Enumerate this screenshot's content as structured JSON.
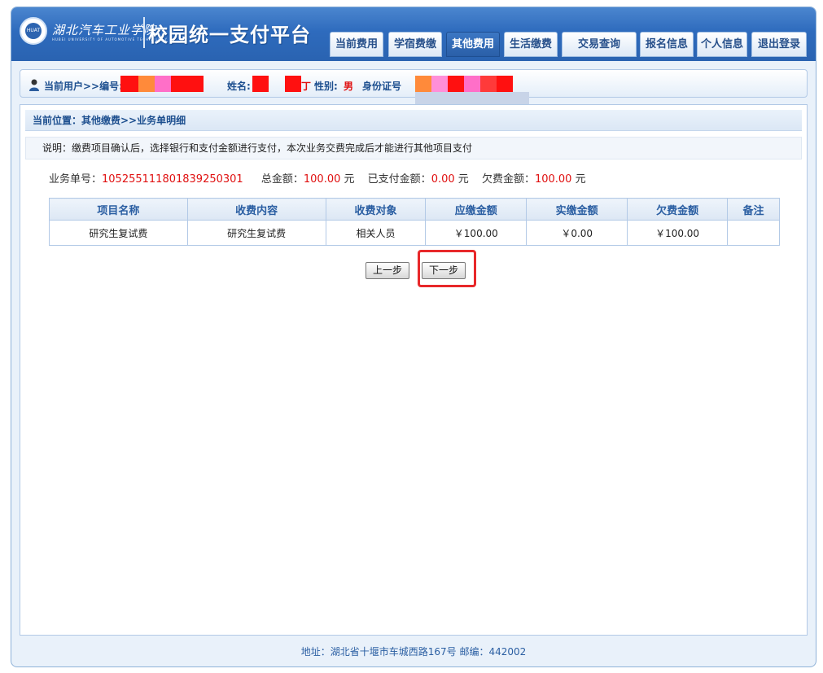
{
  "header": {
    "school_name": "湖北汽车工业学院",
    "school_name_en": "HUBEI UNIVERSITY OF AUTOMOTIVE TECHNOLOGY",
    "platform_title": "校园统一支付平台",
    "emblem_text": "HUAT",
    "nav": [
      {
        "label": "当前费用",
        "active": false
      },
      {
        "label": "学宿费缴",
        "active": false
      },
      {
        "label": "其他费用",
        "active": true
      },
      {
        "label": "生活缴费",
        "active": false
      },
      {
        "label": "交易查询",
        "active": false
      },
      {
        "label": "报名信息",
        "active": false
      },
      {
        "label": "个人信息",
        "active": false
      },
      {
        "label": "退出登录",
        "active": false
      }
    ]
  },
  "user_bar": {
    "current_user_label": "当前用户>>编号:",
    "name_label": "姓名:",
    "name_tail": "丁",
    "gender_label": "性别:",
    "gender_value": "男",
    "id_label": "身份证号"
  },
  "breadcrumb": "当前位置：其他缴费>>业务单明细",
  "notice": "说明：缴费项目确认后，选择银行和支付金额进行支付，本次业务交费完成后才能进行其他项目支付",
  "summary": {
    "order_label": "业务单号：",
    "order_value": "105255111801839250301",
    "total_label": "总金额：",
    "total_value": "100.00",
    "paid_label": "已支付金额：",
    "paid_value": "0.00",
    "owed_label": "欠费金额：",
    "owed_value": "100.00",
    "unit": "元"
  },
  "table": {
    "headers": [
      "项目名称",
      "收费内容",
      "收费对象",
      "应缴金额",
      "实缴金额",
      "欠费金额",
      "备注"
    ],
    "rows": [
      [
        "研究生复试费",
        "研究生复试费",
        "相关人员",
        "￥100.00",
        "￥0.00",
        "￥100.00",
        ""
      ]
    ]
  },
  "buttons": {
    "prev": "上一步",
    "next": "下一步"
  },
  "footer": "地址：湖北省十堰市车城西路167号 邮编：442002",
  "colors": {
    "header_blue": "#2e6bbd",
    "accent_text": "#1d4f8f",
    "value_red": "#e01010",
    "highlight_red": "#e8282a"
  }
}
